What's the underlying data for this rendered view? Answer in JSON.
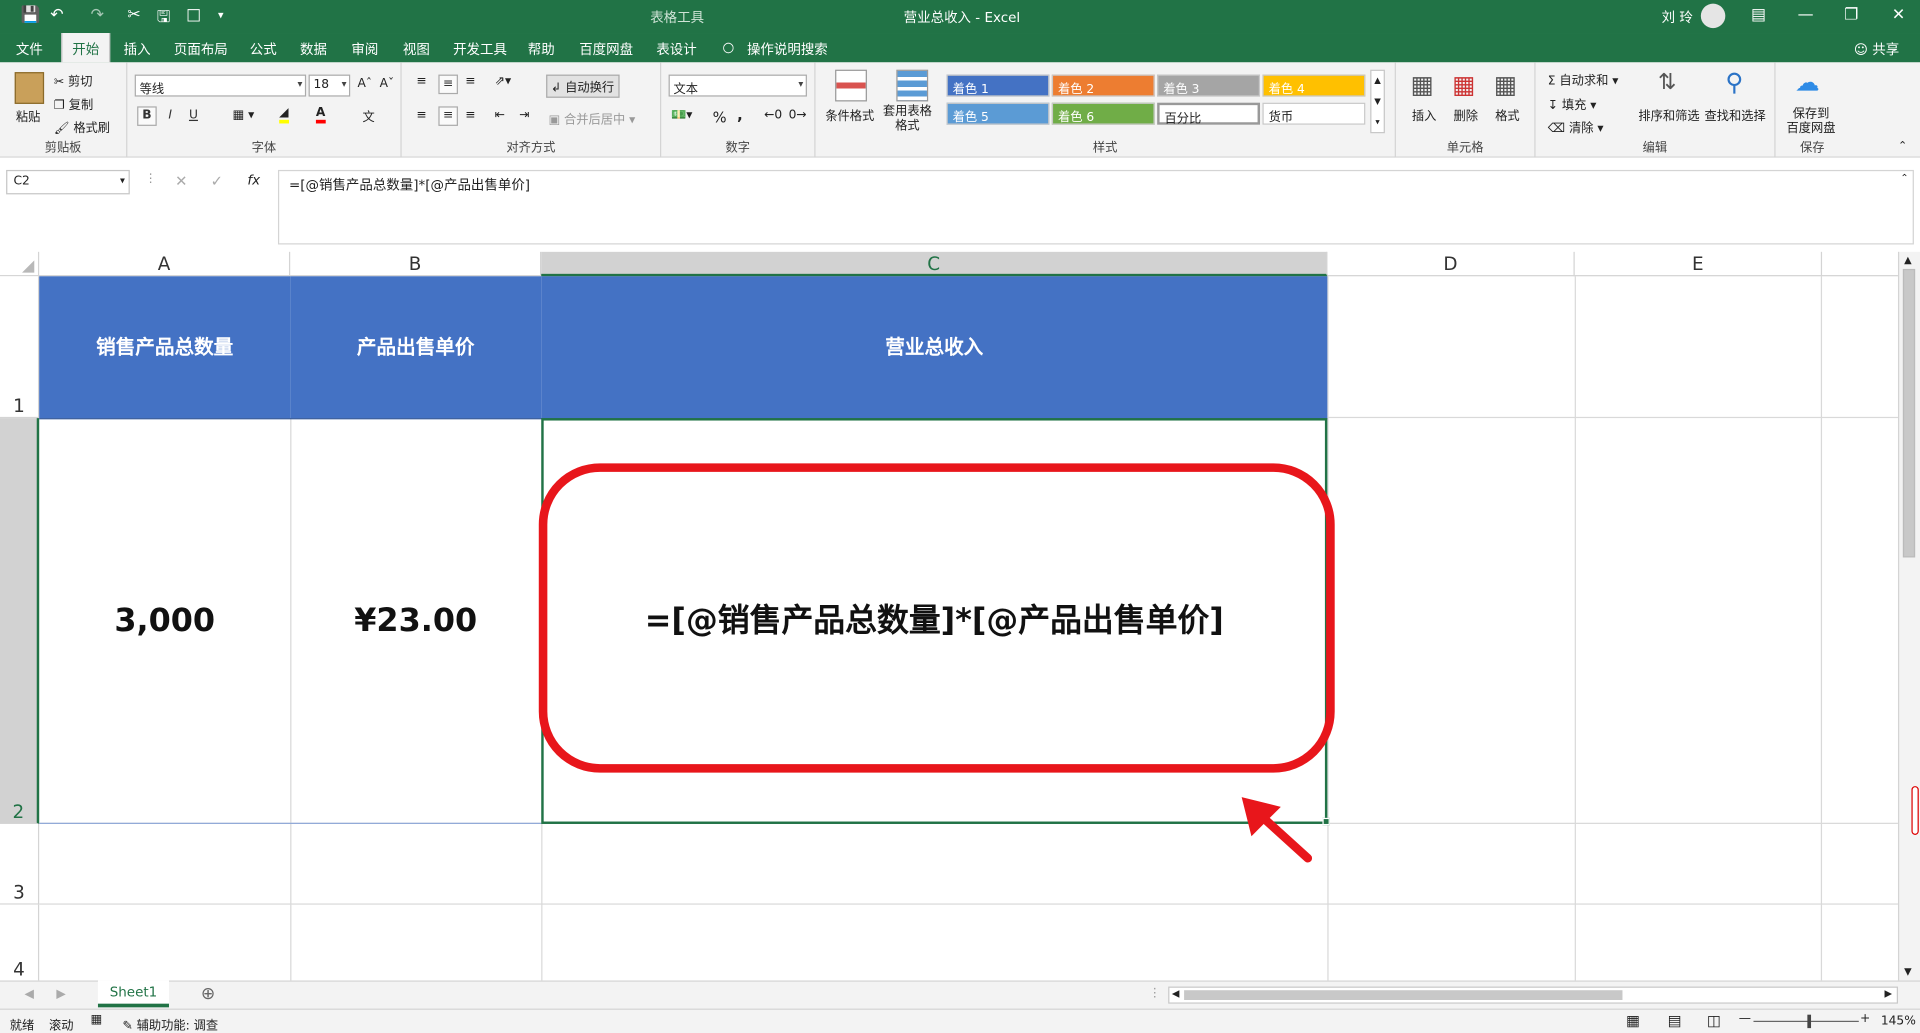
{
  "titlebar": {
    "context_tab": "表格工具",
    "title": "营业总收入 - Excel",
    "user": "刘 玲"
  },
  "tabs": [
    "文件",
    "开始",
    "插入",
    "页面布局",
    "公式",
    "数据",
    "审阅",
    "视图",
    "开发工具",
    "帮助",
    "百度网盘",
    "表设计"
  ],
  "active_tab": "开始",
  "tell_me": "操作说明搜索",
  "share": "共享",
  "ribbon": {
    "clipboard": {
      "paste": "粘贴",
      "cut": "剪切",
      "copy": "复制",
      "painter": "格式刷",
      "label": "剪贴板"
    },
    "font": {
      "name": "等线",
      "size": "18",
      "bold": "B",
      "italic": "I",
      "underline": "U",
      "label": "字体"
    },
    "align": {
      "wrap": "自动换行",
      "merge": "合并后居中",
      "label": "对齐方式"
    },
    "number": {
      "format": "文本",
      "pct": "%",
      "comma": ",",
      "label": "数字"
    },
    "styles": {
      "cond": "条件格式",
      "table": "套用表格格式",
      "label": "样式",
      "swatches": [
        {
          "t": "着色 1",
          "c": "#4472c4"
        },
        {
          "t": "着色 2",
          "c": "#ed7d31"
        },
        {
          "t": "着色 3",
          "c": "#a5a5a5"
        },
        {
          "t": "着色 4",
          "c": "#ffc000"
        },
        {
          "t": "着色 5",
          "c": "#5b9bd5"
        },
        {
          "t": "着色 6",
          "c": "#70ad47"
        }
      ],
      "percent": "百分比",
      "currency": "货币"
    },
    "cells": {
      "insert": "插入",
      "delete": "删除",
      "format": "格式",
      "label": "单元格"
    },
    "editing": {
      "autosum": "自动求和",
      "fill": "填充",
      "clear": "清除",
      "sort": "排序和筛选",
      "find": "查找和选择",
      "label": "编辑"
    },
    "save": {
      "btn1": "保存到",
      "btn2": "百度网盘",
      "label": "保存"
    }
  },
  "formula_bar": {
    "name_box": "C2",
    "formula": "=[@销售产品总数量]*[@产品出售单价]"
  },
  "columns": [
    "A",
    "B",
    "C",
    "D",
    "E"
  ],
  "rows": [
    "1",
    "2",
    "3",
    "4"
  ],
  "table": {
    "headers": [
      "销售产品总数量",
      "产品出售单价",
      "营业总收入"
    ],
    "row2": [
      "3,000",
      "¥23.00",
      "=[@销售产品总数量]*[@产品出售单价]"
    ]
  },
  "sheet_tab": "Sheet1",
  "status": {
    "ready": "就绪",
    "scroll": "滚动",
    "accessibility": "辅助功能: 调查",
    "zoom": "145%"
  },
  "colors": {
    "excel_green": "#217346",
    "header_blue": "#4472c4",
    "annotation_red": "#e8161b"
  }
}
